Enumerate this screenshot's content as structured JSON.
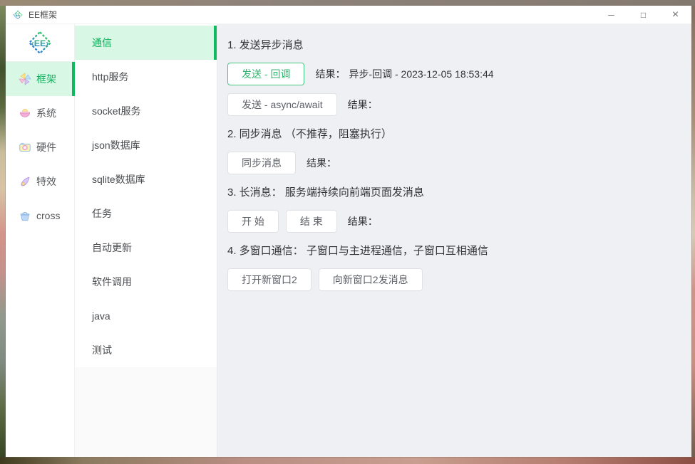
{
  "window": {
    "title": "EE框架",
    "controls": {
      "minimize_glyph": "─",
      "maximize_glyph": "□",
      "close_glyph": "×"
    }
  },
  "sidebar": {
    "logo_text": "EE",
    "items": [
      {
        "label": "框架",
        "icon": "pinwheel-icon",
        "selected": true
      },
      {
        "label": "系统",
        "icon": "bowl-icon",
        "selected": false
      },
      {
        "label": "硬件",
        "icon": "camera-icon",
        "selected": false
      },
      {
        "label": "特效",
        "icon": "comet-icon",
        "selected": false
      },
      {
        "label": "cross",
        "icon": "basket-icon",
        "selected": false
      }
    ]
  },
  "menu": {
    "items": [
      {
        "label": "通信",
        "selected": true
      },
      {
        "label": "http服务",
        "selected": false
      },
      {
        "label": "socket服务",
        "selected": false
      },
      {
        "label": "json数据库",
        "selected": false
      },
      {
        "label": "sqlite数据库",
        "selected": false
      },
      {
        "label": "任务",
        "selected": false
      },
      {
        "label": "自动更新",
        "selected": false
      },
      {
        "label": "软件调用",
        "selected": false
      },
      {
        "label": "java",
        "selected": false
      },
      {
        "label": "测试",
        "selected": false
      }
    ]
  },
  "main": {
    "sections": [
      {
        "heading": "1. 发送异步消息",
        "rows": [
          {
            "buttons": [
              {
                "label": "发送 - 回调",
                "variant": "green"
              }
            ],
            "result_label": "结果：",
            "result_value": "异步-回调 - 2023-12-05 18:53:44"
          },
          {
            "buttons": [
              {
                "label": "发送 - async/await",
                "variant": "default"
              }
            ],
            "result_label": "结果：",
            "result_value": ""
          }
        ]
      },
      {
        "heading": "2. 同步消息 （不推荐，阻塞执行）",
        "rows": [
          {
            "buttons": [
              {
                "label": "同步消息",
                "variant": "default"
              }
            ],
            "result_label": "结果：",
            "result_value": ""
          }
        ]
      },
      {
        "heading": "3. 长消息： 服务端持续向前端页面发消息",
        "rows": [
          {
            "buttons": [
              {
                "label": "开 始",
                "variant": "default"
              },
              {
                "label": "结 束",
                "variant": "default"
              }
            ],
            "result_label": "结果：",
            "result_value": ""
          }
        ]
      },
      {
        "heading": "4. 多窗口通信： 子窗口与主进程通信，子窗口互相通信",
        "rows": [
          {
            "buttons": [
              {
                "label": "打开新窗口2",
                "variant": "default"
              },
              {
                "label": "向新窗口2发消息",
                "variant": "default"
              }
            ]
          }
        ]
      }
    ]
  },
  "colors": {
    "accent_green": "#0eb95f",
    "accent_green_light": "#d9f7e5",
    "green_button_border": "#46c684",
    "content_background": "#eff0f3"
  }
}
